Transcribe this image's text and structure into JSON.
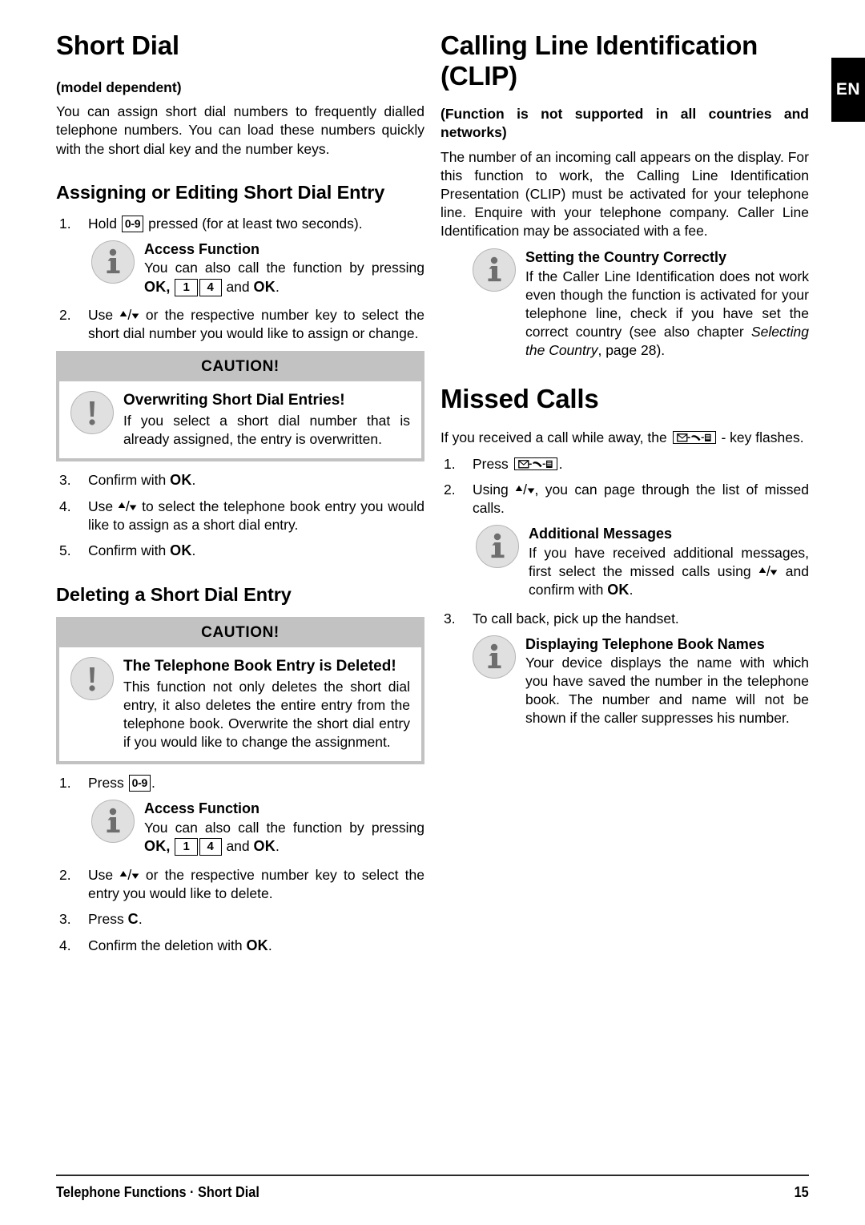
{
  "language_tab": "EN",
  "left_column": {
    "title": "Short Dial",
    "model_note": "(model dependent)",
    "intro": "You can assign short dial numbers to frequently dialled telephone numbers. You can load these numbers quickly with the short dial key and the number keys.",
    "section_assign": {
      "heading": "Assigning or Editing Short Dial Entry",
      "step1_num": "1.",
      "step1_pre": "Hold",
      "step1_key": "0-9",
      "step1_post": "pressed (for at least two seconds).",
      "note1": {
        "icon": "info-icon",
        "title": "Access Function",
        "pre": "You can also call the function by pressing",
        "ok1": "OK,",
        "key_a": "1",
        "key_b": "4",
        "mid": "and",
        "ok2": "OK",
        "end": "."
      },
      "step2_num": "2.",
      "step2_pre": "Use",
      "step2_post": "or the respective number key to select the short dial number you would like to assign or change.",
      "caution": {
        "header": "CAUTION!",
        "icon": "exclamation-icon",
        "title": "Overwriting Short Dial Entries!",
        "body": "If you select a short dial number that is already assigned, the entry is overwritten."
      },
      "step3_num": "3.",
      "step3_pre": "Confirm with",
      "step3_ok": "OK",
      "step3_end": ".",
      "step4_num": "4.",
      "step4_pre": "Use",
      "step4_post": "to select the telephone book entry you would like to assign as a short dial entry.",
      "step5_num": "5.",
      "step5_pre": "Confirm with",
      "step5_ok": "OK",
      "step5_end": "."
    },
    "section_delete": {
      "heading": "Deleting a Short Dial Entry",
      "caution": {
        "header": "CAUTION!",
        "icon": "exclamation-icon",
        "title": "The Telephone Book Entry is Deleted!",
        "body": "This function not only deletes the short dial entry, it also deletes the entire entry from the telephone book. Overwrite the short dial entry if you would like to change the assignment."
      },
      "step1_num": "1.",
      "step1_pre": "Press",
      "step1_key": "0-9",
      "step1_end": ".",
      "note1": {
        "icon": "info-icon",
        "title": "Access Function",
        "pre": "You can also call the function by pressing",
        "ok1": "OK,",
        "key_a": "1",
        "key_b": "4",
        "mid": "and",
        "ok2": "OK",
        "end": "."
      },
      "step2_num": "2.",
      "step2_pre": "Use",
      "step2_post": "or the respective number key to select the entry you would like to delete.",
      "step3_num": "3.",
      "step3_pre": "Press",
      "step3_key": "C",
      "step3_end": ".",
      "step4_num": "4.",
      "step4_pre": "Confirm the deletion with",
      "step4_ok": "OK",
      "step4_end": "."
    }
  },
  "right_column": {
    "title": "Calling Line Identification (CLIP)",
    "support_note": "(Function is not supported in all countries and networks)",
    "intro": "The number of an incoming call appears on the display. For this function to work, the Calling Line Identification Presentation (CLIP) must be activated for your telephone line. Enquire with your telephone company. Caller Line Identification may be associated with a fee.",
    "note_country": {
      "icon": "info-icon",
      "title": "Setting the Country Correctly",
      "body_pre": "If the Caller Line Identification does not work even though the function is activated for your telephone line, check if you have set the correct country (see also chapter ",
      "body_italic": "Selecting the Country",
      "body_post": ", page 28)."
    },
    "section_missed": {
      "heading": "Missed Calls",
      "intro_pre": "If you received a call while away, the",
      "intro_key": "missed-call-key-icon",
      "intro_post": "- key flashes.",
      "step1_num": "1.",
      "step1_pre": "Press",
      "step1_key": "missed-call-key-icon",
      "step1_end": ".",
      "step2_num": "2.",
      "step2_pre": "Using",
      "step2_post": ", you can page through the list of missed calls.",
      "note_messages": {
        "icon": "info-icon",
        "title": "Additional Messages",
        "body_pre": "If you have received additional messages, first select the missed calls using",
        "body_mid": "and confirm with",
        "body_ok": "OK",
        "body_end": "."
      },
      "step3_num": "3.",
      "step3_text": "To call back, pick up the handset.",
      "note_names": {
        "icon": "info-icon",
        "title": "Displaying Telephone Book Names",
        "body": "Your device displays the name with which you have saved the number in the telephone book. The number and name will not be shown if the caller suppresses his number."
      }
    }
  },
  "footer": {
    "breadcrumb": "Telephone Functions · Short Dial",
    "page_number": "15"
  },
  "colors": {
    "caution_frame": "#c2c2c2",
    "icon_fill": "#e0e0e0",
    "icon_stroke": "#b5b5b5",
    "icon_glyph": "#6e6e6e",
    "tab_bg": "#000000",
    "text": "#000000"
  }
}
